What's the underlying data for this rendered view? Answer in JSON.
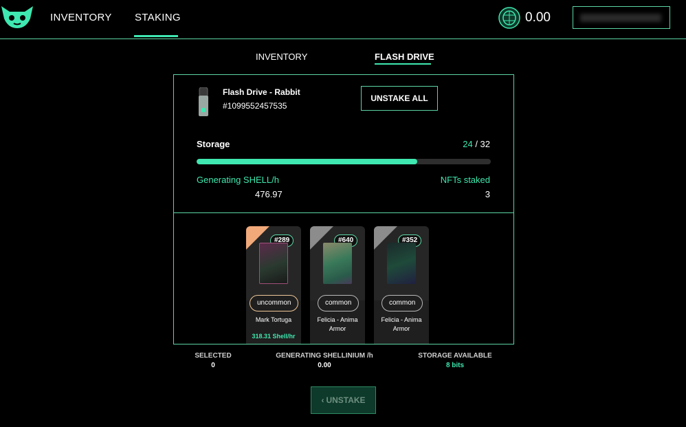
{
  "nav": {
    "items": [
      {
        "label": "INVENTORY"
      },
      {
        "label": "STAKING"
      }
    ],
    "active": "STAKING",
    "wallet_balance": "0.00",
    "wallet_icon": "shell-coin-icon",
    "logo_icon": "fox-logo-icon"
  },
  "subtabs": {
    "items": [
      {
        "label": "INVENTORY"
      },
      {
        "label": "FLASH DRIVE"
      }
    ],
    "active": "FLASH DRIVE"
  },
  "drive": {
    "name": "Flash Drive - Rabbit",
    "id": "#1099552457535",
    "unstake_all_label": "UNSTAKE ALL",
    "storage_label": "Storage",
    "storage_used": "24",
    "storage_total": "/ 32",
    "storage_fraction": 0.75,
    "generating_label": "Generating SHELL/h",
    "generating_value": "476.97",
    "nfts_label": "NFTs staked",
    "nfts_value": "3"
  },
  "cards": [
    {
      "number": "#289",
      "rarity": "uncommon",
      "name": "Mark Tortuga",
      "rate": "318.31 Shell/hr"
    },
    {
      "number": "#640",
      "rarity": "common",
      "name": "Felicia - Anima Armor",
      "rate": ""
    },
    {
      "number": "#352",
      "rarity": "common",
      "name": "Felicia - Anima Armor",
      "rate": ""
    }
  ],
  "stats": {
    "selected_label": "SELECTED",
    "selected_value": "0",
    "generating_label": "GENERATING SHELLINIUM /h",
    "generating_value": "0.00",
    "storage_label": "STORAGE AVAILABLE",
    "storage_value": "8 bits"
  },
  "unstake_label": "UNSTAKE",
  "colors": {
    "accent": "#3ee8b0",
    "border": "#5cd6a5",
    "uncommon": "#f2a97a",
    "common": "#8c8c8c"
  }
}
